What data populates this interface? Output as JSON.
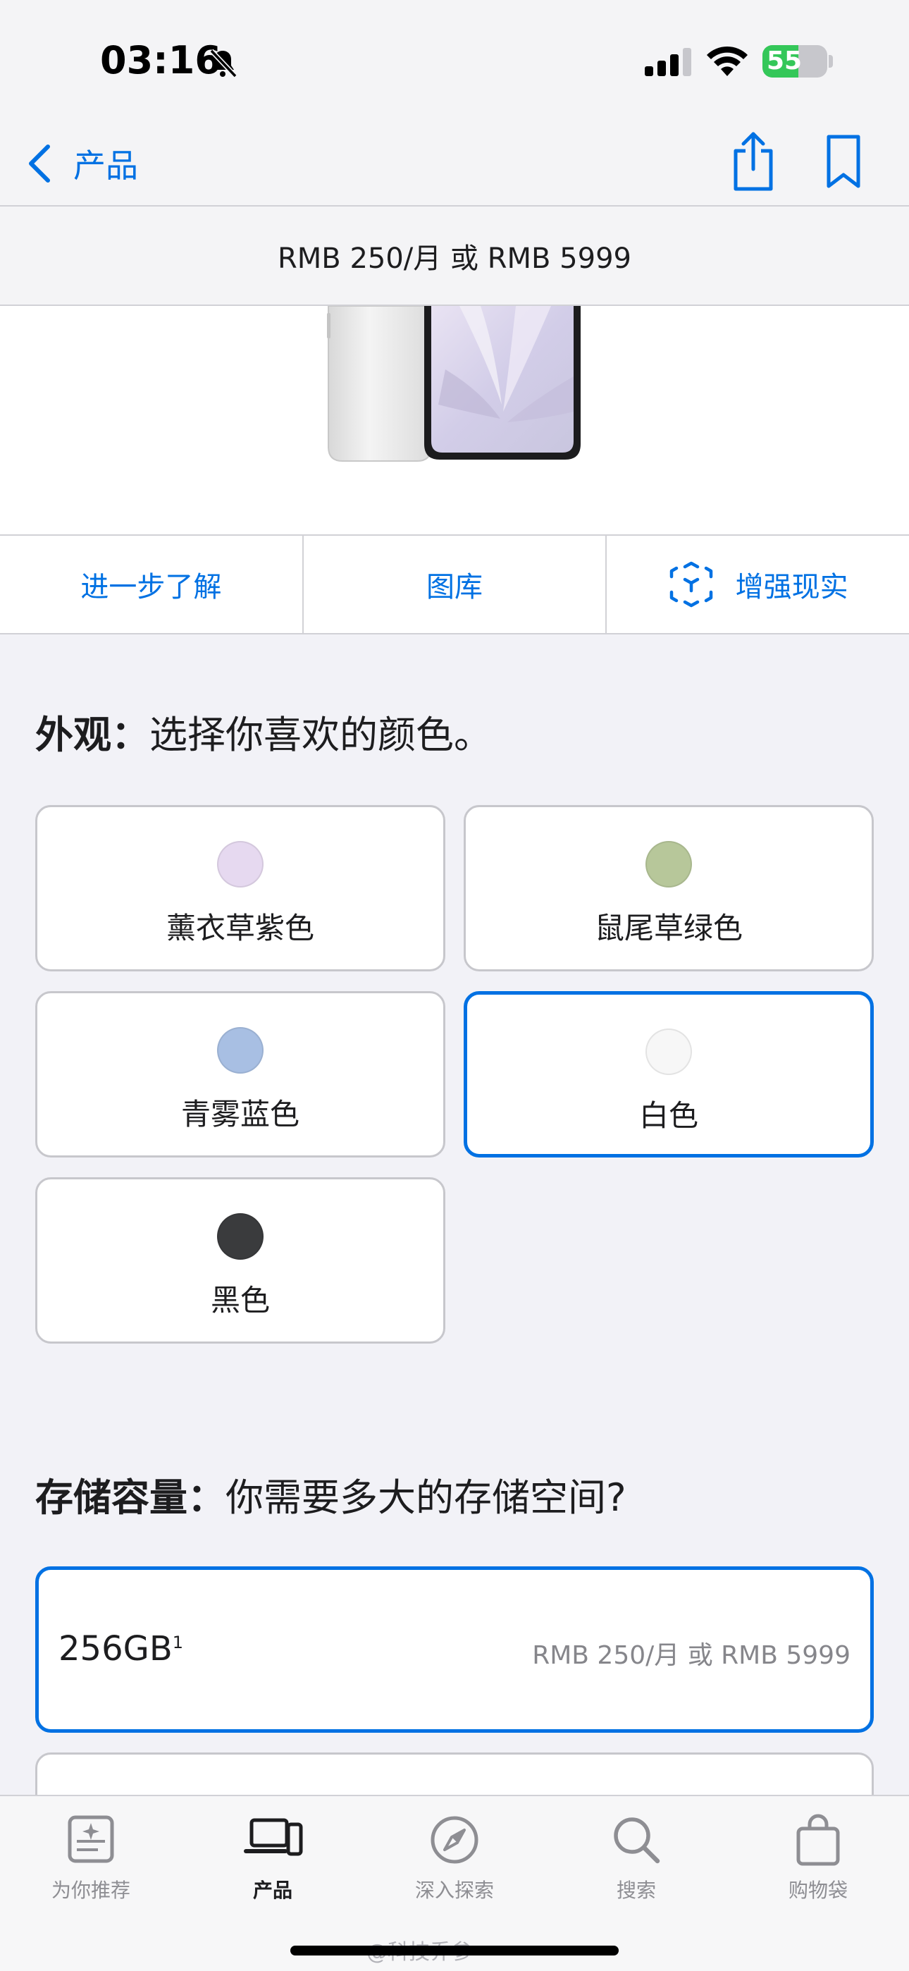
{
  "status_bar": {
    "time": "03:16",
    "battery": "55",
    "battery_level": 0.55
  },
  "nav": {
    "back_label": "产品"
  },
  "price_strip": "RMB 250/月 或 RMB 5999",
  "actions": {
    "learn_more": "进一步了解",
    "gallery": "图库",
    "ar": "增强现实"
  },
  "appearance": {
    "title_bold": "外观：",
    "title_rest": "选择你喜欢的颜色。",
    "colors": [
      {
        "name": "薰衣草紫色",
        "hex": "#e6d9f0",
        "selected": false
      },
      {
        "name": "鼠尾草绿色",
        "hex": "#b7c79a",
        "selected": false
      },
      {
        "name": "青雾蓝色",
        "hex": "#a8bfe3",
        "selected": false
      },
      {
        "name": "白色",
        "hex": "#f7f7f7",
        "selected": true
      },
      {
        "name": "黑色",
        "hex": "#3a3b3d",
        "selected": false
      }
    ]
  },
  "storage": {
    "title_bold": "存储容量：",
    "title_rest": "你需要多大的存储空间?",
    "options": [
      {
        "size": "256GB",
        "footnote": "1",
        "price": "RMB 250/月 或 RMB 5999",
        "selected": true
      }
    ]
  },
  "tab_bar": {
    "tabs": [
      {
        "label": "为你推荐",
        "icon": "recommend-icon",
        "active": false
      },
      {
        "label": "产品",
        "icon": "devices-icon",
        "active": true
      },
      {
        "label": "深入探索",
        "icon": "compass-icon",
        "active": false
      },
      {
        "label": "搜索",
        "icon": "search-icon",
        "active": false
      },
      {
        "label": "购物袋",
        "icon": "bag-icon",
        "active": false
      }
    ]
  },
  "watermark": "@科技乔参丶",
  "colors": {
    "accent": "#0071e3",
    "battery_green": "#34c759"
  }
}
